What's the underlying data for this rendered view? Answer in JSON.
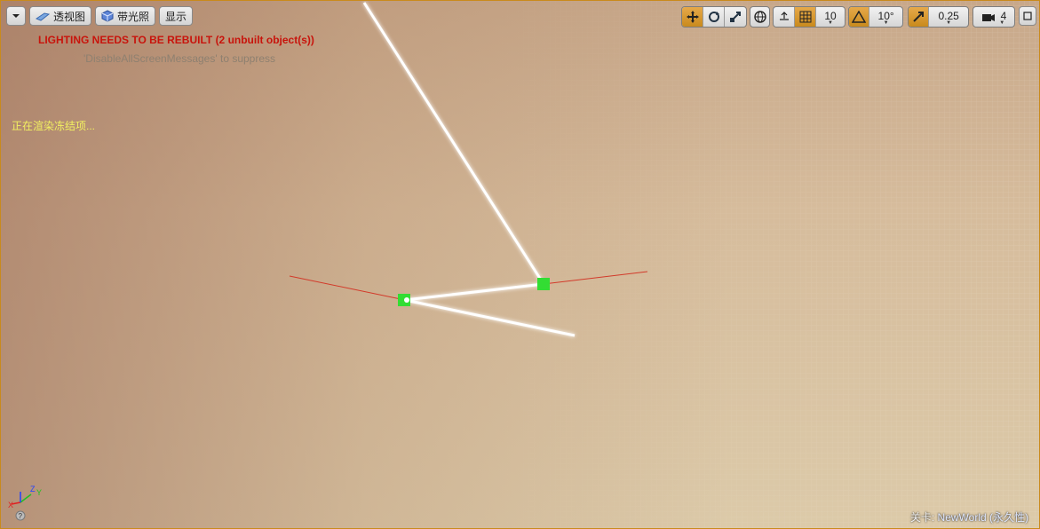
{
  "toolbar": {
    "menu_icon": "chevron-down-icon",
    "perspective_label": "透视图",
    "lit_label": "带光照",
    "show_label": "显示",
    "grid_snap_value": "10",
    "rotation_snap_value": "10°",
    "scale_snap_value": "0.25",
    "camera_speed_value": "4"
  },
  "messages": {
    "lighting_warning": "LIGHTING NEEDS TO BE REBUILT (2 unbuilt object(s))",
    "suppress_hint": "'DisableAllScreenMessages' to suppress",
    "rendering_freeze": "正在渲染冻结项..."
  },
  "status_bar": {
    "level_prefix": "关卡:",
    "level_name": "NewWorld (永久性)"
  },
  "axis_gizmo": {
    "x": "X",
    "y": "Y",
    "z": "Z"
  },
  "colors": {
    "accent": "#c98a1c",
    "warning_red": "#c8140c",
    "hint_yellow": "#f2f060",
    "selection_green": "#33dd33"
  }
}
